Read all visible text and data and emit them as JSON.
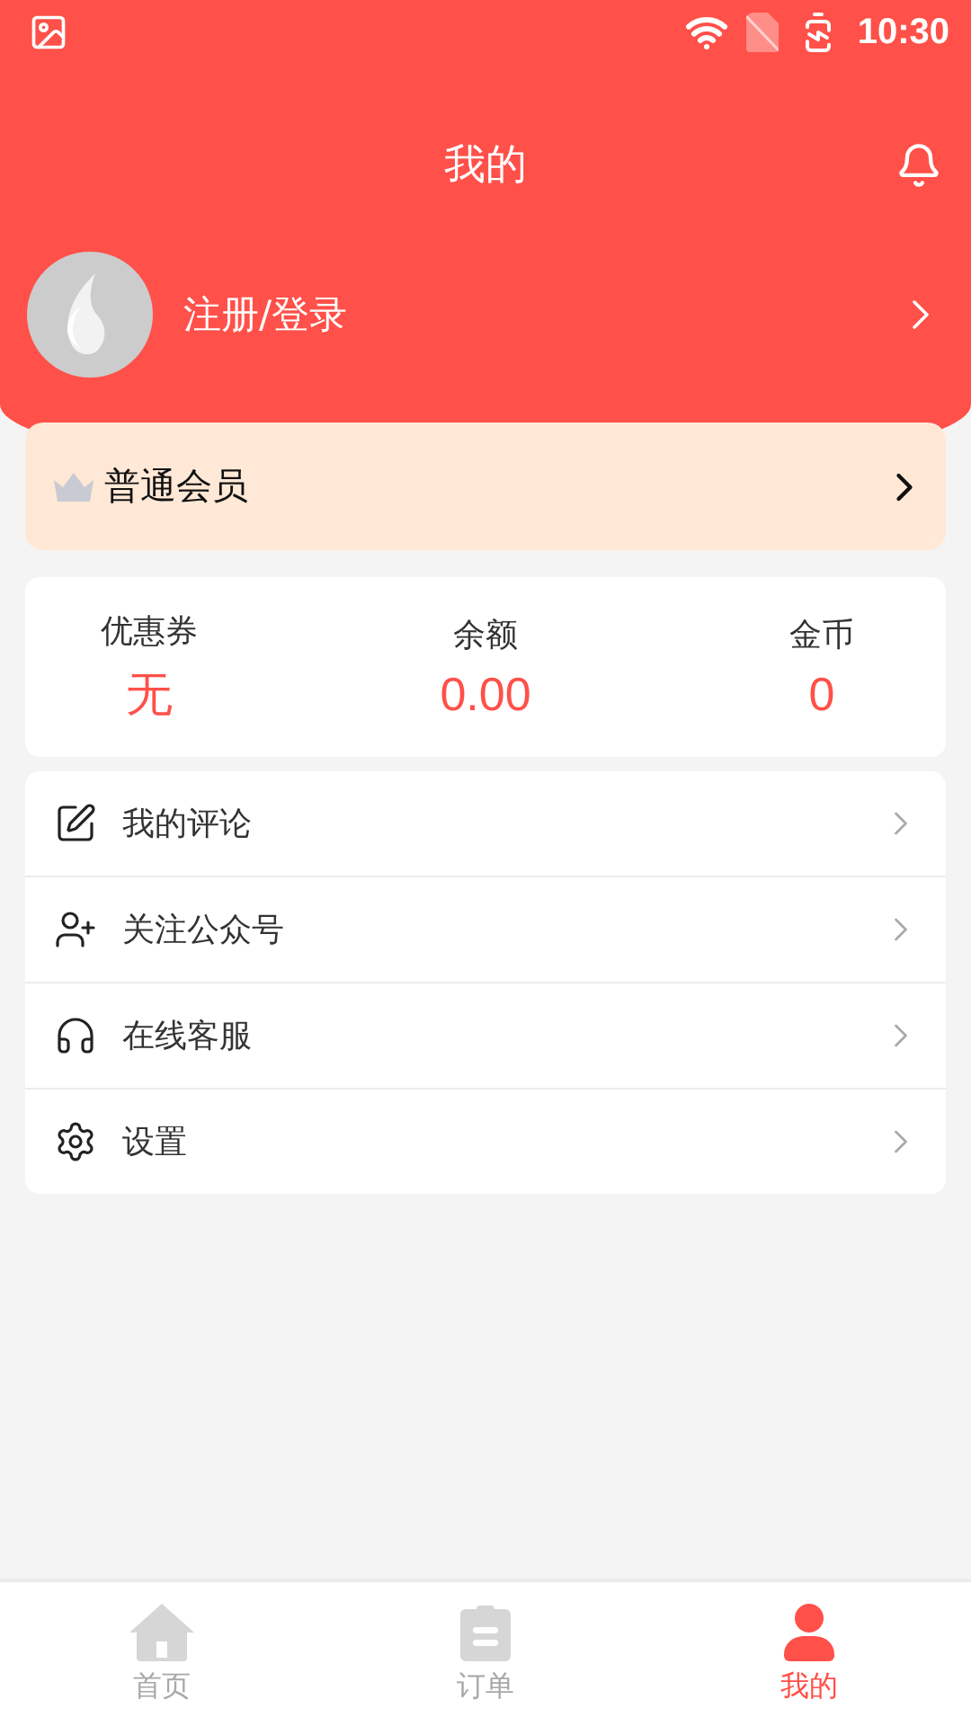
{
  "status_bar": {
    "time": "10:30"
  },
  "header": {
    "title": "我的"
  },
  "profile": {
    "login": "注册/登录"
  },
  "membership": {
    "label": "普通会员"
  },
  "stats": [
    {
      "label": "优惠券",
      "value": "无"
    },
    {
      "label": "余额",
      "value": "0.00"
    },
    {
      "label": "金币",
      "value": "0"
    }
  ],
  "menu": [
    {
      "label": "我的评论"
    },
    {
      "label": "关注公众号"
    },
    {
      "label": "在线客服"
    },
    {
      "label": "设置"
    }
  ],
  "tab_bar": [
    {
      "label": "首页",
      "selected": false
    },
    {
      "label": "订单",
      "selected": false
    },
    {
      "label": "我的",
      "selected": true
    }
  ]
}
